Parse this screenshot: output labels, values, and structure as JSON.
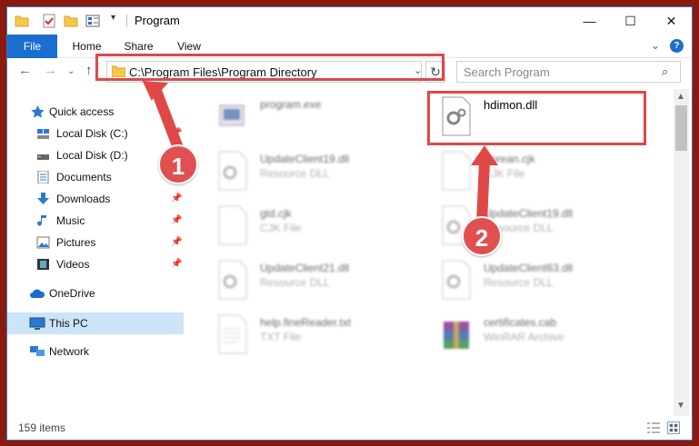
{
  "window": {
    "title": "Program",
    "controls": {
      "minimize": "—",
      "maximize": "☐",
      "close": "✕"
    }
  },
  "ribbon": {
    "tabs": [
      "File",
      "Home",
      "Share",
      "View"
    ],
    "help": "?"
  },
  "nav": {
    "address": "C:\\Program Files\\Program Directory",
    "search_placeholder": "Search Program"
  },
  "sidebar": {
    "items": [
      {
        "label": "Quick access",
        "icon": "star-icon",
        "pinned": false
      },
      {
        "label": "Local Disk (C:)",
        "icon": "drive-icon",
        "pinned": true
      },
      {
        "label": "Local Disk (D:)",
        "icon": "drive-icon",
        "pinned": false
      },
      {
        "label": "Documents",
        "icon": "documents-icon",
        "pinned": true
      },
      {
        "label": "Downloads",
        "icon": "download-icon",
        "pinned": true
      },
      {
        "label": "Music",
        "icon": "music-icon",
        "pinned": true
      },
      {
        "label": "Pictures",
        "icon": "pictures-icon",
        "pinned": true
      },
      {
        "label": "Videos",
        "icon": "videos-icon",
        "pinned": true
      },
      {
        "label": "OneDrive",
        "icon": "cloud-icon",
        "pinned": false
      },
      {
        "label": "This PC",
        "icon": "computer-icon",
        "pinned": false,
        "selected": true
      },
      {
        "label": "Network",
        "icon": "network-icon",
        "pinned": false
      }
    ]
  },
  "files": [
    {
      "name": "program.exe",
      "type": "",
      "icon": "exe-icon"
    },
    {
      "name": "hdimon.dll",
      "type": "",
      "icon": "dll-gear-icon"
    },
    {
      "name": "UpdateClient19.dll",
      "type": "Resource DLL",
      "icon": "dll-gear-icon"
    },
    {
      "name": "Korean.cjk",
      "type": "CJK File",
      "icon": "generic-file-icon"
    },
    {
      "name": "gtd.cjk",
      "type": "CJK File",
      "icon": "generic-file-icon"
    },
    {
      "name": "UpdateClient19.dll",
      "type": "Resource DLL",
      "icon": "dll-gear-icon"
    },
    {
      "name": "UpdateClient21.dll",
      "type": "Resource DLL",
      "icon": "dll-gear-icon"
    },
    {
      "name": "UpdateClient63.dll",
      "type": "Resource DLL",
      "icon": "dll-gear-icon"
    },
    {
      "name": "help.fineReader.txt",
      "type": "TXT File",
      "icon": "text-file-icon"
    },
    {
      "name": "certificates.cab",
      "type": "WinRAR Archive",
      "icon": "winrar-icon"
    }
  ],
  "status": {
    "item_count": "159 items"
  },
  "annotations": {
    "step1": "1",
    "step2": "2",
    "color": "#e04848"
  }
}
